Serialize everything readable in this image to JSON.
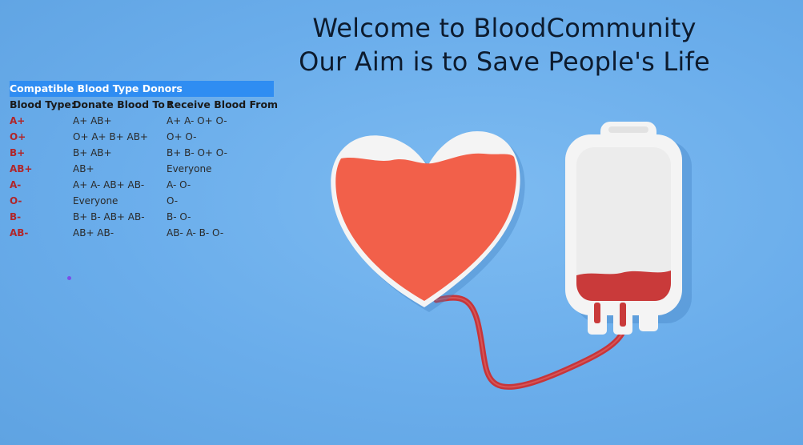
{
  "hero": {
    "line1": "Welcome to BloodCommunity",
    "line2": "Our Aim is to Save People's Life"
  },
  "table": {
    "caption": "Compatible Blood Type Donors",
    "headers": [
      "Blood Type:",
      "Donate Blood To :",
      "Receive Blood From"
    ],
    "rows": [
      {
        "type": "A+",
        "donate": "A+ AB+",
        "receive": "A+ A- O+ O-"
      },
      {
        "type": "O+",
        "donate": "O+ A+ B+ AB+",
        "receive": "O+ O-"
      },
      {
        "type": "B+",
        "donate": "B+ AB+",
        "receive": "B+ B- O+ O-"
      },
      {
        "type": "AB+",
        "donate": "AB+",
        "receive": "Everyone"
      },
      {
        "type": "A-",
        "donate": "A+ A- AB+ AB-",
        "receive": "A- O-"
      },
      {
        "type": "O-",
        "donate": "Everyone",
        "receive": "O-"
      },
      {
        "type": "B-",
        "donate": "B+ B- AB+ AB-",
        "receive": "B- O-"
      },
      {
        "type": "AB-",
        "donate": "AB+ AB-",
        "receive": "AB- A- B- O-"
      }
    ]
  },
  "colors": {
    "background": "#6fb0ea",
    "caption_bg": "#2f8df2",
    "blood_type_text": "#b0262a",
    "heart_red": "#f2604a",
    "bag_blood": "#c93a3a"
  },
  "icons": [
    "heart-icon",
    "blood-bag-icon",
    "tube-icon"
  ]
}
